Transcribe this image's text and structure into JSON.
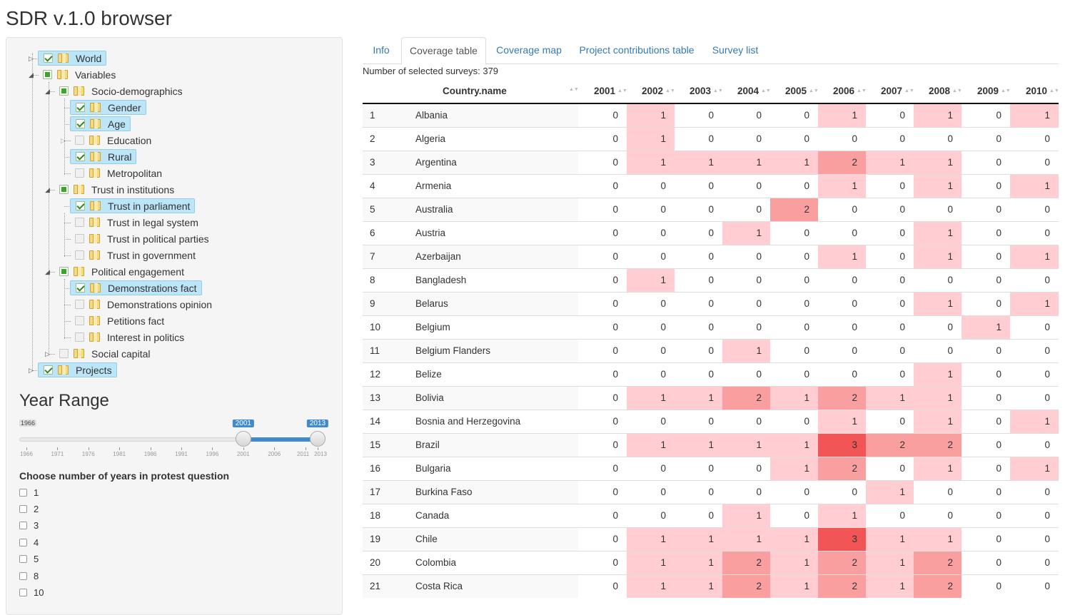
{
  "app": {
    "title": "SDR v.1.0 browser"
  },
  "sidebar": {
    "tree": [
      {
        "label": "World",
        "state": "checked",
        "selected": true
      },
      {
        "label": "Variables",
        "state": "partial",
        "selected": false
      },
      {
        "label": "Socio-demographics",
        "state": "partial",
        "selected": false
      },
      {
        "label": "Gender",
        "state": "checked",
        "selected": true
      },
      {
        "label": "Age",
        "state": "checked",
        "selected": true
      },
      {
        "label": "Education",
        "state": "unchecked",
        "selected": false
      },
      {
        "label": "Rural",
        "state": "checked",
        "selected": true
      },
      {
        "label": "Metropolitan",
        "state": "unchecked",
        "selected": false
      },
      {
        "label": "Trust in institutions",
        "state": "partial",
        "selected": false
      },
      {
        "label": "Trust in parliament",
        "state": "checked",
        "selected": true
      },
      {
        "label": "Trust in legal system",
        "state": "unchecked",
        "selected": false
      },
      {
        "label": "Trust in political parties",
        "state": "unchecked",
        "selected": false
      },
      {
        "label": "Trust in government",
        "state": "unchecked",
        "selected": false
      },
      {
        "label": "Political engagement",
        "state": "partial",
        "selected": false
      },
      {
        "label": "Demonstrations fact",
        "state": "checked",
        "selected": true
      },
      {
        "label": "Demonstrations opinion",
        "state": "unchecked",
        "selected": false
      },
      {
        "label": "Petitions fact",
        "state": "unchecked",
        "selected": false
      },
      {
        "label": "Interest in politics",
        "state": "unchecked",
        "selected": false
      },
      {
        "label": "Social capital",
        "state": "unchecked",
        "selected": false
      },
      {
        "label": "Projects",
        "state": "checked",
        "selected": true
      }
    ],
    "year_range": {
      "title": "Year Range",
      "min": 1966,
      "max": 2013,
      "from": 2001,
      "to": 2013,
      "min_label": "1966",
      "from_label": "2001",
      "to_label": "2013",
      "ticks": [
        "1966",
        "1971",
        "1976",
        "1981",
        "1986",
        "1991",
        "1996",
        "2001",
        "2006",
        "2011",
        "2013"
      ]
    },
    "protest_question": {
      "label": "Choose number of years in protest question",
      "options": [
        "1",
        "2",
        "3",
        "4",
        "5",
        "8",
        "10"
      ]
    }
  },
  "main": {
    "tabs": [
      {
        "label": "Info",
        "active": false
      },
      {
        "label": "Coverage table",
        "active": true
      },
      {
        "label": "Coverage map",
        "active": false
      },
      {
        "label": "Project contributions table",
        "active": false
      },
      {
        "label": "Survey list",
        "active": false
      }
    ],
    "selected_surveys_text": "Number of selected surveys: 379",
    "table": {
      "columns": [
        "",
        "Country.name",
        "2001",
        "2002",
        "2003",
        "2004",
        "2005",
        "2006",
        "2007",
        "2008",
        "2009",
        "2010"
      ],
      "rows": [
        {
          "idx": "1",
          "country": "Albania",
          "values": [
            0,
            1,
            0,
            0,
            0,
            1,
            0,
            1,
            0,
            1
          ]
        },
        {
          "idx": "2",
          "country": "Algeria",
          "values": [
            0,
            1,
            0,
            0,
            0,
            0,
            0,
            0,
            0,
            0
          ]
        },
        {
          "idx": "3",
          "country": "Argentina",
          "values": [
            0,
            1,
            1,
            1,
            1,
            2,
            1,
            1,
            0,
            0
          ]
        },
        {
          "idx": "4",
          "country": "Armenia",
          "values": [
            0,
            0,
            0,
            0,
            0,
            1,
            0,
            1,
            0,
            1
          ]
        },
        {
          "idx": "5",
          "country": "Australia",
          "values": [
            0,
            0,
            0,
            0,
            2,
            0,
            0,
            0,
            0,
            0
          ]
        },
        {
          "idx": "6",
          "country": "Austria",
          "values": [
            0,
            0,
            0,
            1,
            0,
            0,
            0,
            1,
            0,
            0
          ]
        },
        {
          "idx": "7",
          "country": "Azerbaijan",
          "values": [
            0,
            0,
            0,
            0,
            0,
            1,
            0,
            1,
            0,
            1
          ]
        },
        {
          "idx": "8",
          "country": "Bangladesh",
          "values": [
            0,
            1,
            0,
            0,
            0,
            0,
            0,
            0,
            0,
            0
          ]
        },
        {
          "idx": "9",
          "country": "Belarus",
          "values": [
            0,
            0,
            0,
            0,
            0,
            0,
            0,
            1,
            0,
            1
          ]
        },
        {
          "idx": "10",
          "country": "Belgium",
          "values": [
            0,
            0,
            0,
            0,
            0,
            0,
            0,
            0,
            1,
            0
          ]
        },
        {
          "idx": "11",
          "country": "Belgium Flanders",
          "values": [
            0,
            0,
            0,
            1,
            0,
            0,
            0,
            0,
            0,
            0
          ]
        },
        {
          "idx": "12",
          "country": "Belize",
          "values": [
            0,
            0,
            0,
            0,
            0,
            0,
            0,
            1,
            0,
            0
          ]
        },
        {
          "idx": "13",
          "country": "Bolivia",
          "values": [
            0,
            1,
            1,
            2,
            1,
            2,
            1,
            1,
            0,
            0
          ]
        },
        {
          "idx": "14",
          "country": "Bosnia and Herzegovina",
          "values": [
            0,
            0,
            0,
            0,
            0,
            1,
            0,
            1,
            0,
            1
          ]
        },
        {
          "idx": "15",
          "country": "Brazil",
          "values": [
            0,
            1,
            1,
            1,
            1,
            3,
            2,
            2,
            0,
            0
          ]
        },
        {
          "idx": "16",
          "country": "Bulgaria",
          "values": [
            0,
            0,
            0,
            0,
            1,
            2,
            0,
            1,
            0,
            1
          ]
        },
        {
          "idx": "17",
          "country": "Burkina Faso",
          "values": [
            0,
            0,
            0,
            0,
            0,
            0,
            1,
            0,
            0,
            0
          ]
        },
        {
          "idx": "18",
          "country": "Canada",
          "values": [
            0,
            0,
            0,
            1,
            0,
            1,
            0,
            0,
            0,
            0
          ]
        },
        {
          "idx": "19",
          "country": "Chile",
          "values": [
            0,
            1,
            1,
            1,
            1,
            3,
            1,
            1,
            0,
            0
          ]
        },
        {
          "idx": "20",
          "country": "Colombia",
          "values": [
            0,
            1,
            1,
            2,
            1,
            2,
            1,
            2,
            0,
            0
          ]
        },
        {
          "idx": "21",
          "country": "Costa Rica",
          "values": [
            0,
            1,
            1,
            2,
            1,
            2,
            1,
            2,
            0,
            0
          ]
        }
      ]
    }
  }
}
